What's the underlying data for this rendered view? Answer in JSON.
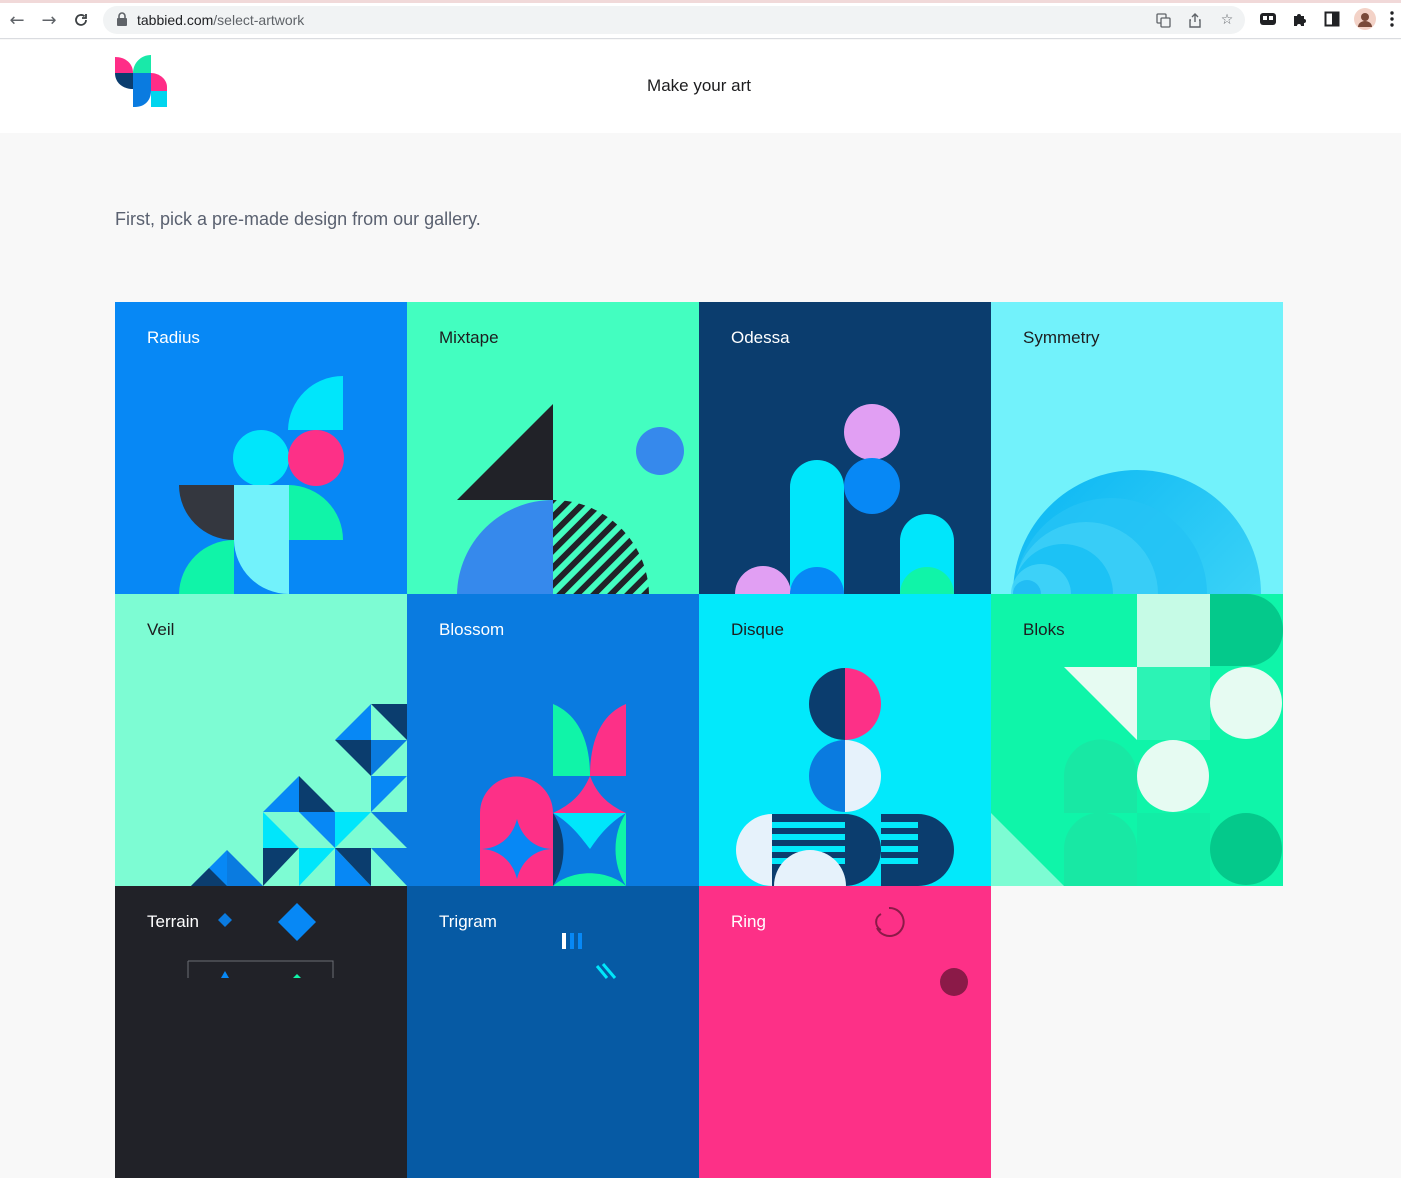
{
  "browser": {
    "url_domain": "tabbied.com",
    "url_path": "/select-artwork"
  },
  "header": {
    "title": "Make your art"
  },
  "intro": "First, pick a pre-made design from our gallery.",
  "artworks": [
    {
      "name": "Radius",
      "bg": "#0788f5",
      "text_color": "#ffffff"
    },
    {
      "name": "Mixtape",
      "bg": "#43fec0",
      "text_color": "#1d1d1f"
    },
    {
      "name": "Odessa",
      "bg": "#0b3d6e",
      "text_color": "#ffffff"
    },
    {
      "name": "Symmetry",
      "bg": "#72f2fb",
      "text_color": "#1d1d1f"
    },
    {
      "name": "Veil",
      "bg": "#7dfcd3",
      "text_color": "#1d1d1f"
    },
    {
      "name": "Blossom",
      "bg": "#0a7be0",
      "text_color": "#ffffff"
    },
    {
      "name": "Disque",
      "bg": "#02e9fb",
      "text_color": "#1d1d1f"
    },
    {
      "name": "Bloks",
      "bg": "#0ff5a9",
      "text_color": "#1d1d1f"
    },
    {
      "name": "Terrain",
      "bg": "#212228",
      "text_color": "#ffffff"
    },
    {
      "name": "Trigram",
      "bg": "#065aa4",
      "text_color": "#ffffff"
    },
    {
      "name": "Ring",
      "bg": "#fd3087",
      "text_color": "#ffffff"
    }
  ]
}
